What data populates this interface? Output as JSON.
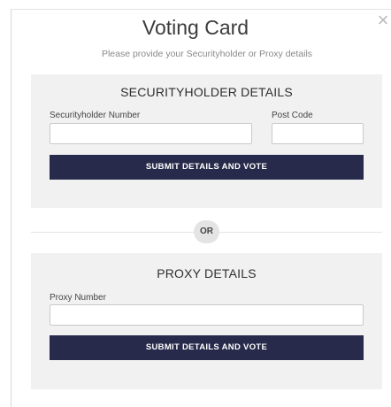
{
  "dialog": {
    "title": "Voting Card",
    "subtitle": "Please provide your Securityholder or Proxy details",
    "close_glyph": "×"
  },
  "securityholder": {
    "heading": "SECURITYHOLDER DETAILS",
    "number_label": "Securityholder Number",
    "number_value": "",
    "postcode_label": "Post Code",
    "postcode_value": "",
    "submit_label": "SUBMIT DETAILS AND VOTE"
  },
  "divider": {
    "label": "OR"
  },
  "proxy": {
    "heading": "PROXY DETAILS",
    "number_label": "Proxy Number",
    "number_value": "",
    "submit_label": "SUBMIT DETAILS AND VOTE"
  },
  "colors": {
    "button": "#272a4a",
    "panel": "#f0f1f0"
  },
  "icons": {
    "close": "close-icon"
  }
}
